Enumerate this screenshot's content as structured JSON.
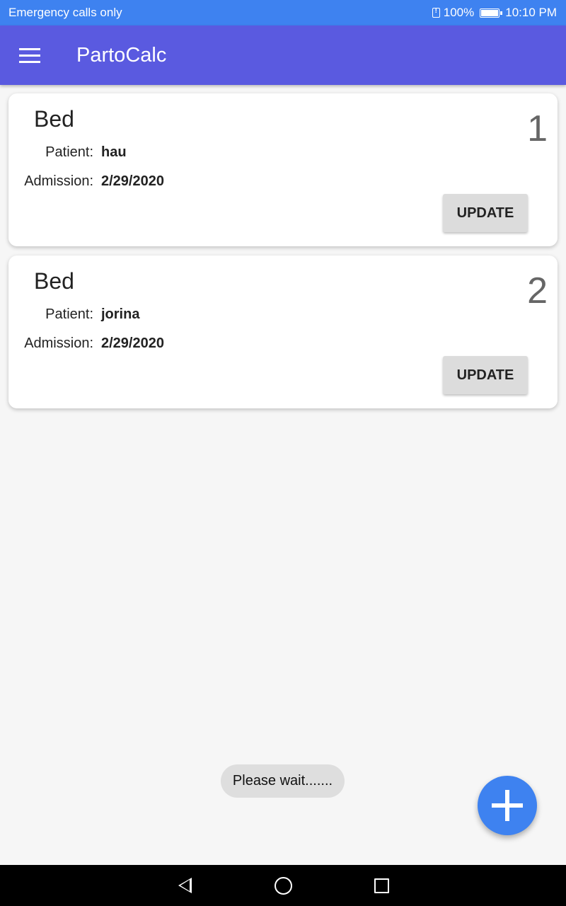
{
  "status_bar": {
    "carrier_text": "Emergency calls only",
    "battery_percent": "100%",
    "time": "10:10 PM"
  },
  "app_bar": {
    "title": "PartoCalc",
    "menu_icon": "hamburger-menu-icon",
    "color": "#5a5ae0"
  },
  "beds": [
    {
      "title": "Bed",
      "number": "1",
      "patient_label": "Patient:",
      "patient": "hau",
      "admission_label": "Admission:",
      "admission": "2/29/2020",
      "update_label": "UPDATE"
    },
    {
      "title": "Bed",
      "number": "2",
      "patient_label": "Patient:",
      "patient": "jorina",
      "admission_label": "Admission:",
      "admission": "2/29/2020",
      "update_label": "UPDATE"
    }
  ],
  "toast": {
    "text": "Please wait......."
  },
  "fab": {
    "icon": "plus-icon",
    "color": "#3e82f0"
  },
  "nav_bar": {
    "icons": [
      "back-icon",
      "home-icon",
      "recents-icon"
    ]
  }
}
